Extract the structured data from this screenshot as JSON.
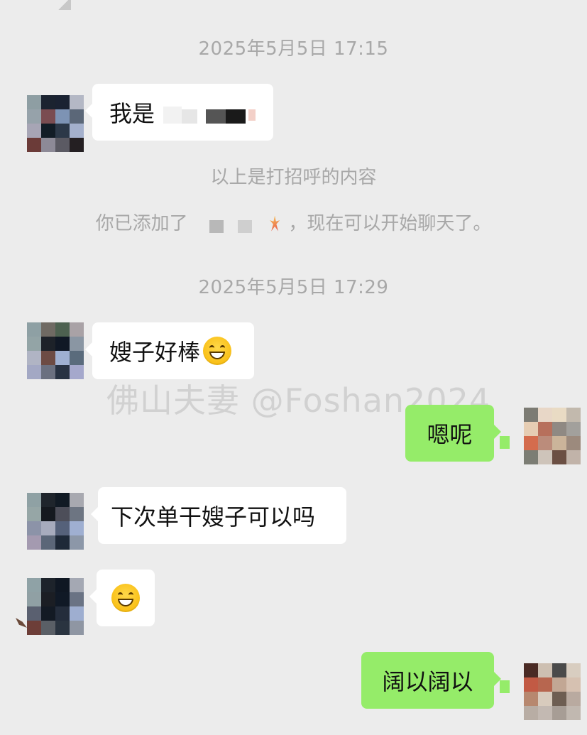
{
  "chat": {
    "timestamp_1": "2025年5月5日 17:15",
    "greeting_prefix": "我是",
    "system_greeting": "以上是打招呼的内容",
    "system_added_prefix": "你已添加了",
    "system_added_suffix": "，现在可以开始聊天了。",
    "timestamp_2": "2025年5月5日 17:29",
    "msg_1": "嫂子好棒",
    "msg_2": "嗯呢",
    "msg_3": "下次单干嫂子可以吗",
    "msg_5": "阔以阔以"
  },
  "watermark": "佛山夫妻 @Foshan2024",
  "icons": {
    "grin": "grinning-face-emoji",
    "sparkle": "sparkle-emoji"
  },
  "colors": {
    "background": "#ececec",
    "incoming_bubble": "#ffffff",
    "outgoing_bubble": "#95ec69",
    "system_text": "#a8a8a8"
  }
}
